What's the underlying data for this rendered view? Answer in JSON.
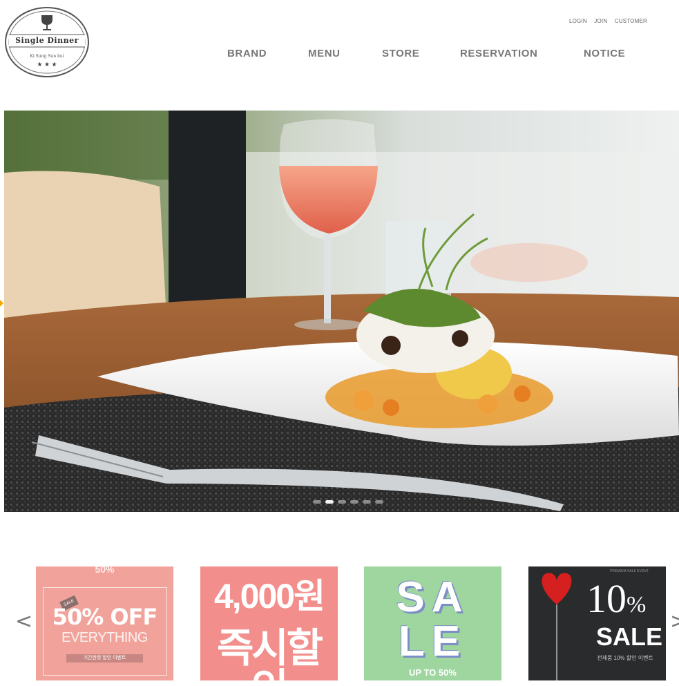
{
  "brand": {
    "name": "Single Dinner",
    "tagline": "Ki Sung Sun hui",
    "stars": "★ ★ ★"
  },
  "utility_nav": [
    {
      "label": "LOGIN"
    },
    {
      "label": "JOIN"
    },
    {
      "label": "CUSTOMER"
    }
  ],
  "main_nav": [
    {
      "label": "BRAND"
    },
    {
      "label": "MENU"
    },
    {
      "label": "STORE"
    },
    {
      "label": "RESERVATION"
    },
    {
      "label": "NOTICE"
    }
  ],
  "hero": {
    "slide_count": 6,
    "active_slide": 2
  },
  "promo": {
    "prev_icon": "chevron-left-icon",
    "prev_label": "<",
    "next_icon": "chevron-right-icon",
    "next_label": ">",
    "cards": [
      {
        "top": "50%",
        "headline": "50% OFF",
        "sub": "EVERYTHING",
        "note": "기간한정 할인 이벤트",
        "tag": "SALE"
      },
      {
        "line1": "4,000원",
        "line2": "즉시할인"
      },
      {
        "line1": "SA",
        "line2": "LE",
        "sub": "UP TO 50%"
      },
      {
        "top": "PREMIUM SALE EVENT",
        "big": "10",
        "pct": "%",
        "sale": "SALE",
        "note": "전제품 10% 할인 이벤트"
      }
    ]
  },
  "colors": {
    "nav_text": "#777777",
    "accent_arrow": "#f2a900",
    "card1_bg": "#f1a39b",
    "card2_bg": "#f28e8b",
    "card3_bg": "#9fd59e",
    "card4_bg": "#2a2b2c"
  }
}
